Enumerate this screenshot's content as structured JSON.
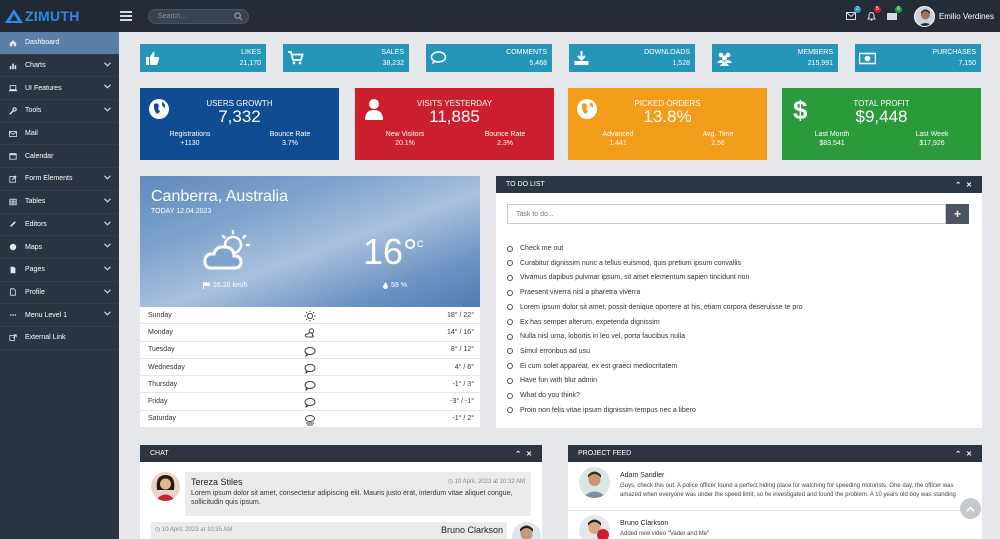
{
  "app": {
    "brand": "ZIMUTH"
  },
  "topbar": {
    "search_placeholder": "Search...",
    "badges": [
      "2",
      "5",
      "6"
    ],
    "user_name": "Emilio Verdines"
  },
  "sidebar": {
    "items": [
      {
        "label": "Dashboard",
        "icon": "home-icon",
        "has_children": false
      },
      {
        "label": "Charts",
        "icon": "bar-chart-icon",
        "has_children": true
      },
      {
        "label": "UI Features",
        "icon": "laptop-icon",
        "has_children": true
      },
      {
        "label": "Tools",
        "icon": "wrench-icon",
        "has_children": true
      },
      {
        "label": "Mail",
        "icon": "envelope-icon",
        "has_children": false
      },
      {
        "label": "Calendar",
        "icon": "calendar-icon",
        "has_children": false
      },
      {
        "label": "Form Elements",
        "icon": "pencil-square-icon",
        "has_children": true
      },
      {
        "label": "Tables",
        "icon": "table-icon",
        "has_children": true
      },
      {
        "label": "Editors",
        "icon": "pencil-icon",
        "has_children": true
      },
      {
        "label": "Maps",
        "icon": "globe-icon",
        "has_children": true
      },
      {
        "label": "Pages",
        "icon": "file-icon",
        "has_children": true
      },
      {
        "label": "Profile",
        "icon": "file-outline-icon",
        "has_children": true
      },
      {
        "label": "Menu Level 1",
        "icon": "ellipsis-icon",
        "has_children": true
      },
      {
        "label": "External Link",
        "icon": "external-link-icon",
        "has_children": false
      }
    ]
  },
  "stats": [
    {
      "label": "LIKES",
      "value": "21,170",
      "icon": "thumbs-up-icon"
    },
    {
      "label": "SALES",
      "value": "38,232",
      "icon": "cart-icon"
    },
    {
      "label": "COMMENTS",
      "value": "5,468",
      "icon": "comment-icon"
    },
    {
      "label": "DOWNLOADS",
      "value": "1,528",
      "icon": "download-icon"
    },
    {
      "label": "MEMBERS",
      "value": "215,991",
      "icon": "users-icon"
    },
    {
      "label": "PURCHASES",
      "value": "7,150",
      "icon": "money-icon"
    }
  ],
  "big_cards": [
    {
      "title": "USERS GROWTH",
      "value": "7,332",
      "left_label": "Registrations",
      "left_value": "+1130",
      "right_label": "Bounce Rate",
      "right_value": "3.7%",
      "color": "#0f4c91",
      "icon": "globe-icon"
    },
    {
      "title": "VISITS YESTERDAY",
      "value": "11,885",
      "left_label": "New Visitors",
      "left_value": "20.1%",
      "right_label": "Bounce Rate",
      "right_value": "2.3%",
      "color": "#cc1f2e",
      "icon": "user-icon"
    },
    {
      "title": "PICKED ORDERS",
      "value": "13.8%",
      "left_label": "Advanced",
      "left_value": "1,441",
      "right_label": "Avg. Time",
      "right_value": "2.56",
      "color": "#f39c1a",
      "icon": "globe-icon"
    },
    {
      "title": "TOTAL PROFIT",
      "value": "$9,448",
      "left_label": "Last Month",
      "left_value": "$83,541",
      "right_label": "Last Week",
      "right_value": "$17,926",
      "color": "#2a9a3a",
      "icon": "dollar-icon"
    }
  ],
  "weather": {
    "city": "Canberra, Australia",
    "date": "TODAY 12.04.2023",
    "temp": "16°",
    "unit": "C",
    "wind": "26.20 km/h",
    "humidity": "59 %",
    "days": [
      {
        "day": "Sunday",
        "temp": "18° / 22°",
        "icon": "sun-icon"
      },
      {
        "day": "Monday",
        "temp": "14° / 16°",
        "icon": "partly-cloudy-icon"
      },
      {
        "day": "Tuesday",
        "temp": "8° / 12°",
        "icon": "cloud-icon"
      },
      {
        "day": "Wednesday",
        "temp": "4° / 6°",
        "icon": "cloud-icon"
      },
      {
        "day": "Thursday",
        "temp": "-1° / 3°",
        "icon": "cloud-icon"
      },
      {
        "day": "Friday",
        "temp": "-3° / -1°",
        "icon": "cloud-icon"
      },
      {
        "day": "Saturday",
        "temp": "-1° / 2°",
        "icon": "snow-cloud-icon"
      }
    ]
  },
  "todo": {
    "title": "TO DO LIST",
    "placeholder": "Task to do...",
    "items": [
      "Check me out",
      "Curabitur dignissim nunc a tellus euismod, quis pretium ipsum convallis",
      "Vivamus dapibus pulvinar ipsum, sit amet elementum sapien tincidunt non",
      "Praesent viverra nisl a pharetra viverra",
      "Lorem ipsum dolor sit amet, possit denique oportere at his, etiam corpora deseruisse te pro",
      "Ex has semper alterum, expetenda dignissim",
      "Nulla nisl urna, lobortis in leo vel, porta faucibus nulla",
      "Simul erroribus ad usu",
      "Ei cum solet appareat, ex est graeci mediocritatem",
      "Have fun with blur admin",
      "What do you think?",
      "Proin non felis vitae ipsum dignissim tempus nec a libero"
    ]
  },
  "chat": {
    "title": "CHAT",
    "messages": [
      {
        "name": "Tereza Stiles",
        "time": "10 April, 2023 at 10:32 AM",
        "text": "Lorem ipsum dolor sit amet, consectetur adipiscing elit. Mauris justo erat, interdum vitae aliquet congue, sollicitudin quis ipsum."
      },
      {
        "name": "Bruno Clarkson",
        "time": "10 April, 2023 at 10:35 AM"
      }
    ]
  },
  "feed": {
    "title": "PROJECT FEED",
    "items": [
      {
        "name": "Adam Sandler",
        "text": "Guys, check this out: A police officer found a perfect hiding place for watching for speeding motorists. One day, the officer was amazed when everyone was under the speed limit, so he investigated and found the problem. A 10 years old boy was standing"
      },
      {
        "name": "Bruno Clarkson",
        "text": "Added new video \"Vader and Me\""
      }
    ]
  }
}
